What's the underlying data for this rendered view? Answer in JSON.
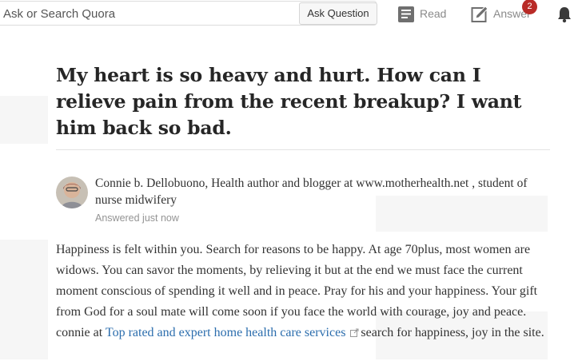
{
  "header": {
    "search_placeholder": "Ask or Search Quora",
    "ask_button": "Ask Question",
    "nav": {
      "read_label": "Read",
      "read_icon": "read-icon",
      "answer_label": "Answer",
      "answer_icon": "pencil-icon",
      "answer_badge": "2",
      "notifications_icon": "bell-icon"
    }
  },
  "question": {
    "title": "My heart is so heavy and hurt. How can I relieve pain from the recent breakup? I want him back so bad."
  },
  "answer": {
    "author_credential": "Connie b. Dellobuono, Health author and blogger at www.motherhealth.net , student of nurse midwifery",
    "answered_time": "Answered just now",
    "body_text": "Happiness is felt within you. Search for reasons to be happy. At age 70plus, most women are widows. You can savor the moments, by relieving it but at the end we must face the current moment conscious of spending it well and in peace. Pray for his and your happiness. Your gift from God for a soul mate will come soon if you face the world with courage, joy and peace. connie at ",
    "link_text": "Top rated and expert home health care services",
    "after_link_text": "search for happiness, joy in the site."
  },
  "colors": {
    "badge": "#b92b27",
    "link": "#2b6dad",
    "nav_text": "#8a8a8a"
  }
}
